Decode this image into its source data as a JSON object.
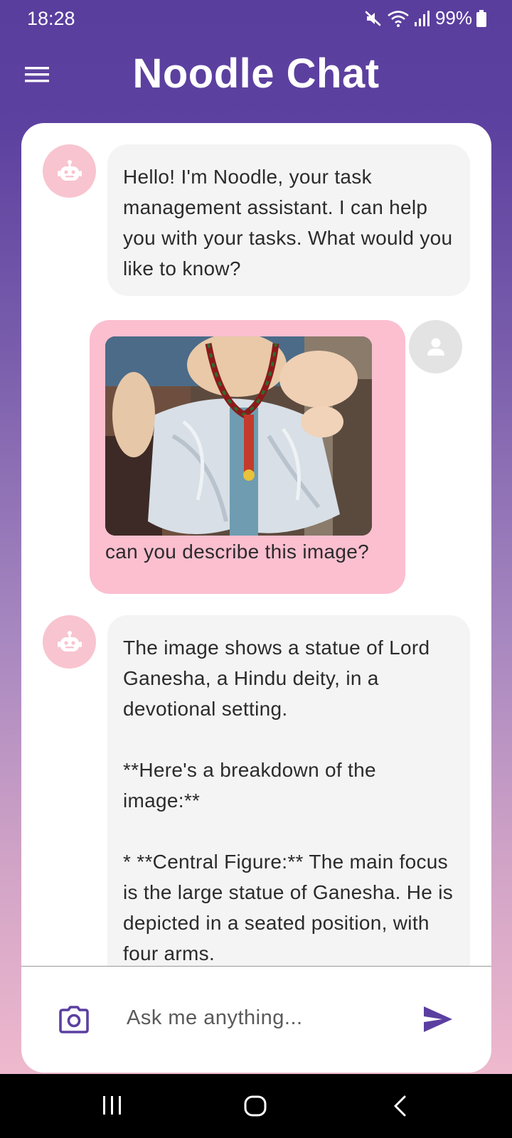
{
  "status_bar": {
    "time": "18:28",
    "battery": "99%",
    "icons": [
      "mute-icon",
      "wifi-icon",
      "signal-icon",
      "battery-icon"
    ]
  },
  "app_bar": {
    "title": "Noodle Chat",
    "menu_icon": "hamburger-menu-icon"
  },
  "messages": [
    {
      "sender": "bot",
      "avatar_icon": "robot-icon",
      "text": "Hello! I'm Noodle, your task management assistant. I can help you with your tasks. What would you like to know?"
    },
    {
      "sender": "user",
      "avatar_icon": "person-icon",
      "has_image": true,
      "text": "can you describe this image?"
    },
    {
      "sender": "bot",
      "avatar_icon": "robot-icon",
      "text": "The image shows a statue of Lord Ganesha, a Hindu deity, in a devotional setting.\n\n**Here's a breakdown of the image:**\n\n* **Central Figure:** The main focus is the large statue of Ganesha. He is depicted in a seated position, with four arms."
    }
  ],
  "input": {
    "placeholder": "Ask me anything...",
    "value": "",
    "camera_icon": "camera-icon",
    "send_icon": "send-icon"
  },
  "colors": {
    "app_bar": "#5d41a0",
    "accent": "#5b3fa0",
    "user_bubble": "#fbbfd0",
    "bot_bubble": "#f4f4f4",
    "bot_avatar": "#f8c4cf"
  },
  "nav_bar": {
    "icons": [
      "recent-apps-icon",
      "home-icon",
      "back-icon"
    ]
  }
}
